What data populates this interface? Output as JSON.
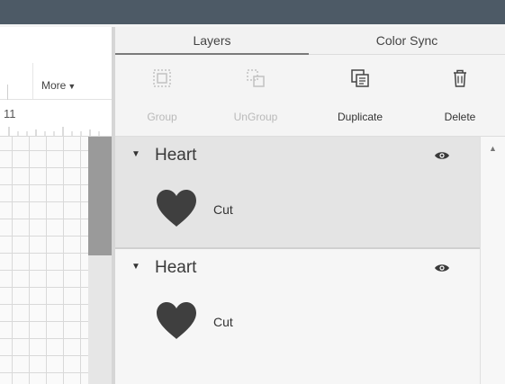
{
  "toolbar": {
    "more_label": "More",
    "more_caret": "▼"
  },
  "ruler": {
    "label": "11"
  },
  "tabs": [
    {
      "label": "Layers",
      "active": true
    },
    {
      "label": "Color Sync",
      "active": false
    }
  ],
  "actions": [
    {
      "label": "Group",
      "icon": "group-icon",
      "enabled": false
    },
    {
      "label": "UnGroup",
      "icon": "ungroup-icon",
      "enabled": false
    },
    {
      "label": "Duplicate",
      "icon": "duplicate-icon",
      "enabled": true
    },
    {
      "label": "Delete",
      "icon": "trash-icon",
      "enabled": true
    }
  ],
  "layers": [
    {
      "name": "Heart",
      "expanded": true,
      "selected": true,
      "visible": true,
      "items": [
        {
          "shape": "heart-icon",
          "operation": "Cut",
          "color": "#3f3f3f"
        }
      ]
    },
    {
      "name": "Heart",
      "expanded": true,
      "selected": false,
      "visible": true,
      "items": [
        {
          "shape": "heart-icon",
          "operation": "Cut",
          "color": "#3f3f3f"
        }
      ]
    }
  ],
  "colors": {
    "topbar": "#4d5a66",
    "selected_layer": "#e4e4e4",
    "heart": "#3f3f3f"
  }
}
